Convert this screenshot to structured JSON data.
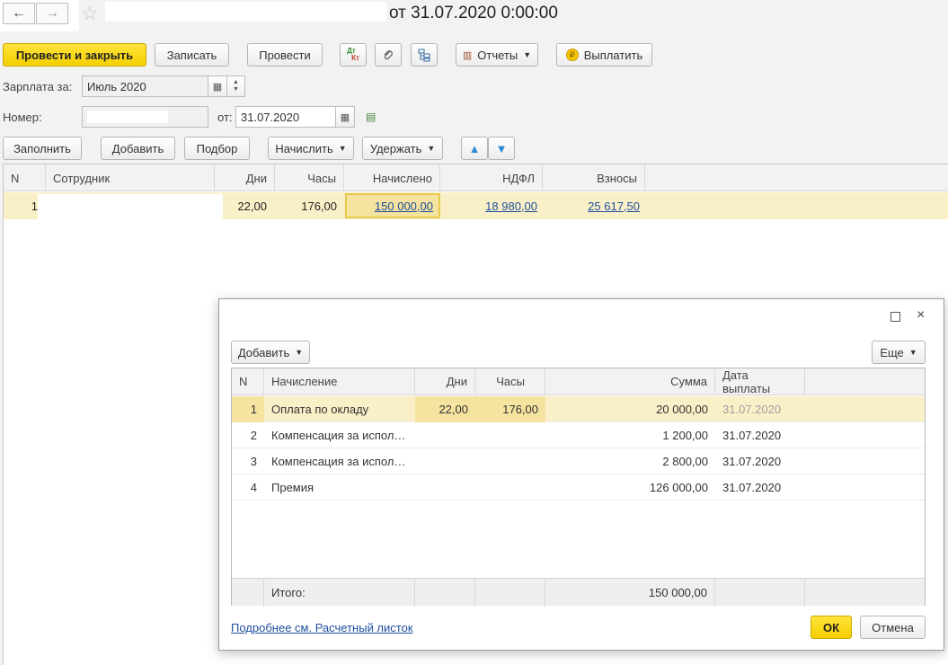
{
  "titlebar": {
    "title": "от 31.07.2020 0:00:00",
    "back_icon": "←",
    "forward_icon": "→",
    "star_icon": "☆"
  },
  "toolbar": {
    "post_close": "Провести и закрыть",
    "save": "Записать",
    "post": "Провести",
    "dtkt_icon_top": "Дт",
    "dtkt_icon_bottom": "Кт",
    "reports": "Отчеты",
    "pay": "Выплатить"
  },
  "form": {
    "salary_label": "Зарплата за:",
    "salary_value": "Июль 2020",
    "number_label": "Номер:",
    "from_label": "от:",
    "date_value": "31.07.2020"
  },
  "table_toolbar": {
    "fill": "Заполнить",
    "add": "Добавить",
    "pick": "Подбор",
    "accrue": "Начислить",
    "withhold": "Удержать"
  },
  "main_table": {
    "headers": {
      "n": "N",
      "employee": "Сотрудник",
      "days": "Дни",
      "hours": "Часы",
      "accrued": "Начислено",
      "ndfl": "НДФЛ",
      "contrib": "Взносы"
    },
    "rows": [
      {
        "n": "1",
        "days": "22,00",
        "hours": "176,00",
        "accrued": "150 000,00",
        "ndfl": "18 980,00",
        "contrib": "25 617,50"
      }
    ]
  },
  "dialog": {
    "add": "Добавить",
    "more": "Еще",
    "headers": {
      "n": "N",
      "accrual": "Начисление",
      "days": "Дни",
      "hours": "Часы",
      "sum": "Сумма",
      "paydate": "Дата выплаты"
    },
    "rows": [
      {
        "n": "1",
        "accrual": "Оплата по окладу",
        "days": "22,00",
        "hours": "176,00",
        "sum": "20 000,00",
        "paydate": "31.07.2020"
      },
      {
        "n": "2",
        "accrual": "Компенсация за испол…",
        "days": "",
        "hours": "",
        "sum": "1 200,00",
        "paydate": "31.07.2020"
      },
      {
        "n": "3",
        "accrual": "Компенсация за испол…",
        "days": "",
        "hours": "",
        "sum": "2 800,00",
        "paydate": "31.07.2020"
      },
      {
        "n": "4",
        "accrual": "Премия",
        "days": "",
        "hours": "",
        "sum": "126 000,00",
        "paydate": "31.07.2020"
      }
    ],
    "total_label": "Итого:",
    "total_sum": "150 000,00",
    "link": "Подробнее см. Расчетный листок",
    "ok": "ОК",
    "cancel": "Отмена"
  },
  "colors": {
    "accent_yellow": "#f5cf00",
    "selection": "#faf0c8",
    "link": "#1d4f9c"
  }
}
